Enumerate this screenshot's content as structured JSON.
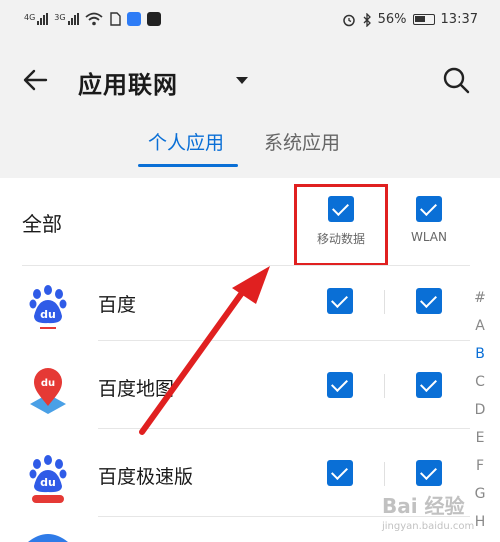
{
  "status_bar": {
    "left_signal_1": "4G",
    "left_signal_2": "3G",
    "battery_percent": "56%",
    "time": "13:37"
  },
  "header": {
    "title": "应用联网",
    "back_icon": "back-arrow-icon",
    "dropdown_icon": "caret-down-icon",
    "search_icon": "search-icon"
  },
  "tabs": [
    {
      "label": "个人应用",
      "active": true
    },
    {
      "label": "系统应用",
      "active": false
    }
  ],
  "list_header": {
    "all_label": "全部",
    "mobile_data_label": "移动数据",
    "wlan_label": "WLAN",
    "mobile_data_checked": true,
    "wlan_checked": true
  },
  "apps": [
    {
      "name": "百度",
      "mobile_data": true,
      "wlan": true,
      "icon": "baidu-icon"
    },
    {
      "name": "百度地图",
      "mobile_data": true,
      "wlan": true,
      "icon": "baidu-map-icon"
    },
    {
      "name": "百度极速版",
      "mobile_data": true,
      "wlan": true,
      "icon": "baidu-lite-icon"
    }
  ],
  "alpha_index": [
    "#",
    "A",
    "B",
    "C",
    "D",
    "E",
    "F",
    "G",
    "H"
  ],
  "alpha_index_active": "B",
  "watermark": {
    "brand": "Bai 经验",
    "url": "jingyan.baidu.com"
  },
  "colors": {
    "accent": "#0a6fd6",
    "highlight_red": "#e02020",
    "header_bg": "#f2f2f2"
  }
}
